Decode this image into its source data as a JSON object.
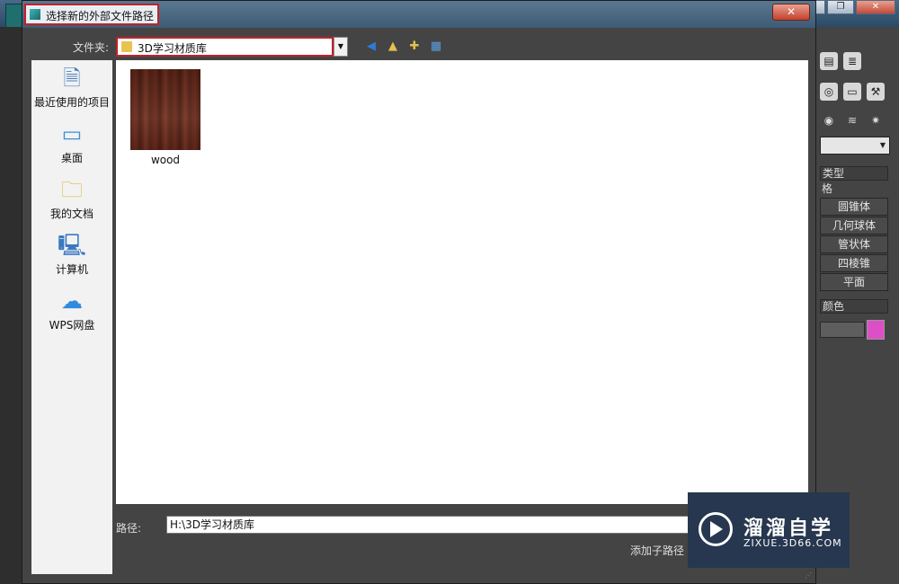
{
  "background_app": {
    "right_panel_buttons": [
      "圆锥体",
      "几何球体",
      "管状体",
      "四棱锥",
      "平面"
    ],
    "section_labels": [
      "类型",
      "格",
      "颜色"
    ],
    "color_swatch": "#dd4fc7"
  },
  "dialog": {
    "title": "选择新的外部文件路径",
    "close_label": "✕",
    "folder_label": "文件夹:",
    "folder_value": "3D学习材质库",
    "nav_icons": [
      "back-icon",
      "up-folder-icon",
      "new-folder-icon",
      "view-menu-icon"
    ],
    "places": [
      {
        "label": "最近使用的项目",
        "icon": "recent-items-icon"
      },
      {
        "label": "桌面",
        "icon": "desktop-icon"
      },
      {
        "label": "我的文档",
        "icon": "documents-icon"
      },
      {
        "label": "计算机",
        "icon": "computer-icon"
      },
      {
        "label": "WPS网盘",
        "icon": "cloud-icon"
      }
    ],
    "files": [
      {
        "name": "wood"
      }
    ],
    "path_label": "路径:",
    "path_value": "H:\\3D学习材质库",
    "add_subpath_label": "添加子路径"
  },
  "watermark": {
    "brand": "溜溜自学",
    "url": "ZIXUE.3D66.COM"
  }
}
